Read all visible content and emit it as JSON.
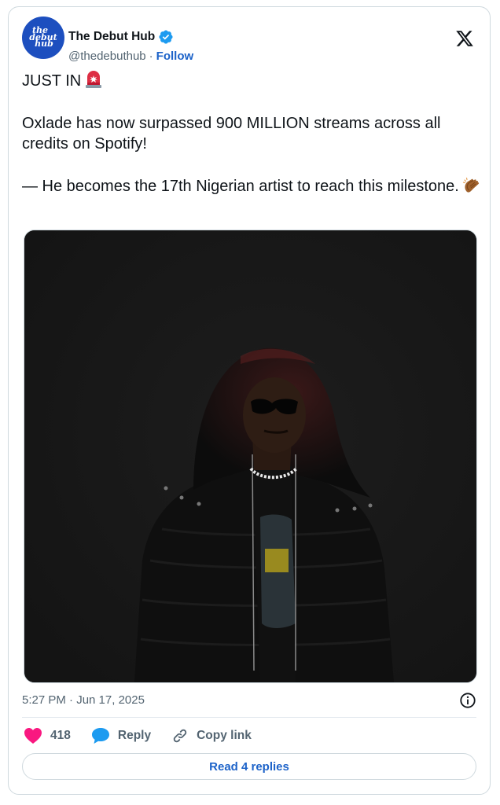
{
  "account": {
    "name": "The Debut Hub",
    "handle": "@thedebuthub",
    "separator": "·",
    "follow_label": "Follow",
    "avatar_text": [
      "the",
      "debut",
      "hub"
    ]
  },
  "tweet": {
    "line1": "JUST IN",
    "line2": "Oxlade has now surpassed 900 MILLION streams across all credits on Spotify!",
    "line3": "— He becomes the 17th Nigerian artist to reach this milestone."
  },
  "meta": {
    "timestamp": "5:27 PM · Jun 17, 2025"
  },
  "actions": {
    "like_count": "418",
    "reply_label": "Reply",
    "copy_label": "Copy link"
  },
  "replies_button": "Read 4 replies",
  "colors": {
    "accent": "#1d63c9",
    "like": "#f91880",
    "verified": "#1d9bf0",
    "avatar_bg": "#1d4fbf"
  },
  "icons": [
    "verified-badge-icon",
    "x-logo-icon",
    "siren-emoji-icon",
    "clap-emoji-icon",
    "info-icon",
    "heart-icon",
    "speech-bubble-icon",
    "link-icon"
  ]
}
